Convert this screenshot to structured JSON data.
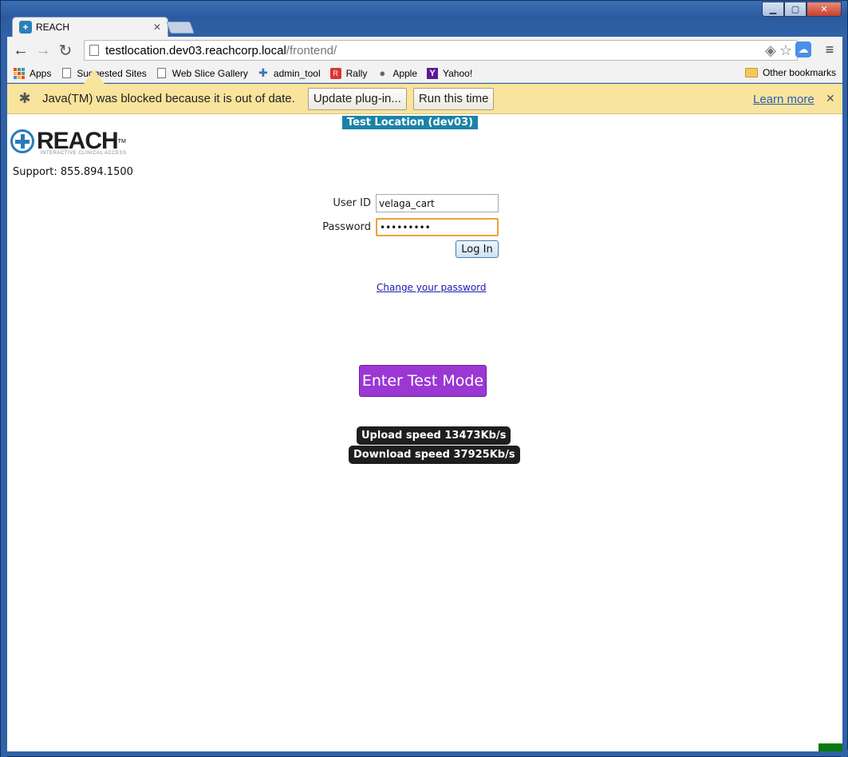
{
  "browser": {
    "tab": {
      "title": "REACH",
      "favicon": "reach-icon"
    },
    "url": {
      "host": "testlocation.dev03.reachcorp.local",
      "path": "/frontend/"
    },
    "bookmarks": [
      {
        "label": "Apps",
        "icon": "apps-grid-icon"
      },
      {
        "label": "Suggested Sites",
        "icon": "document-icon"
      },
      {
        "label": "Web Slice Gallery",
        "icon": "document-icon"
      },
      {
        "label": "admin_tool",
        "icon": "python-icon"
      },
      {
        "label": "Rally",
        "icon": "rally-icon"
      },
      {
        "label": "Apple",
        "icon": "apple-icon"
      },
      {
        "label": "Yahoo!",
        "icon": "yahoo-icon"
      }
    ],
    "other_bookmarks": "Other bookmarks",
    "infobar": {
      "message": "Java(TM) was blocked because it is out of date.",
      "update_button": "Update plug-in...",
      "run_button": "Run this time",
      "learn_more": "Learn more"
    }
  },
  "page": {
    "environment_badge": "Test Location (dev03)",
    "logo": {
      "word": "REACH",
      "tm": "TM",
      "tagline": "INTERACTIVE CLINICAL ACCESS"
    },
    "support": "Support: 855.894.1500",
    "login": {
      "user_label": "User ID",
      "user_value": "velaga_cart",
      "password_label": "Password",
      "password_value": "•••••••••",
      "login_button": "Log In",
      "change_password": "Change your password"
    },
    "test_mode_button": "Enter Test Mode",
    "upload_speed": "Upload speed 13473Kb/s",
    "download_speed": "Download speed 37925Kb/s"
  },
  "colors": {
    "accent_purple": "#9b37d3",
    "badge_blue": "#1b83a8",
    "infobar_yellow": "#f9e49d",
    "status_green": "#0b7a0b"
  }
}
